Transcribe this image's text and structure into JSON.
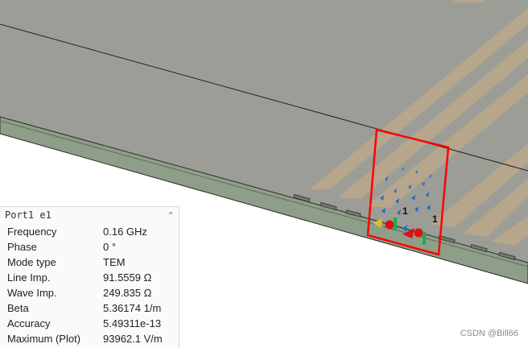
{
  "port_panel": {
    "title": "Port1 e1",
    "rows": [
      {
        "label": "Frequency",
        "value": "0.16 GHz"
      },
      {
        "label": "Phase",
        "value": "0 °"
      },
      {
        "label": "Mode type",
        "value": "TEM"
      },
      {
        "label": "Line Imp.",
        "value": "91.5559 Ω"
      },
      {
        "label": "Wave Imp.",
        "value": "249.835 Ω"
      },
      {
        "label": "Beta",
        "value": "5.36174 1/m"
      },
      {
        "label": "Accuracy",
        "value": "5.49311e-13"
      },
      {
        "label": "Maximum (Plot)",
        "value": "93962.1 V/m"
      }
    ]
  },
  "viewport": {
    "port_markers": [
      "1",
      "1"
    ]
  },
  "watermark": "CSDN @Bill66",
  "colors": {
    "ground_plane": "#9c9d96",
    "substrate": "#8e9e88",
    "trace": "#c2ab88",
    "port_frame": "#ff0000",
    "field_arrow": "#2a68c8",
    "port_arrow_red": "#dd1111",
    "port_arrow_green": "#20aa50",
    "port_arrow_yellow": "#d8c020"
  }
}
